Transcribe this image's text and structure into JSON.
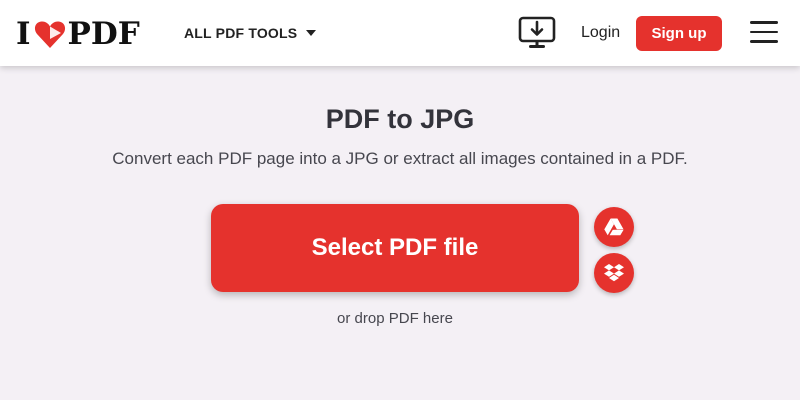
{
  "header": {
    "logo": {
      "prefix": "I",
      "suffix": "PDF"
    },
    "tools_menu_label": "ALL PDF TOOLS",
    "desktop_icon": "desktop-download-icon",
    "login_label": "Login",
    "signup_label": "Sign up",
    "menu_icon": "hamburger-menu-icon"
  },
  "main": {
    "title": "PDF to JPG",
    "subtitle": "Convert each PDF page into a JPG or extract all images contained in a PDF.",
    "select_button_label": "Select PDF file",
    "cloud_buttons": [
      {
        "icon": "google-drive-icon"
      },
      {
        "icon": "dropbox-icon"
      }
    ],
    "drop_hint": "or drop PDF here"
  },
  "colors": {
    "brand_red": "#e5322d",
    "background": "#f4f0f5",
    "text_dark": "#33333b"
  }
}
